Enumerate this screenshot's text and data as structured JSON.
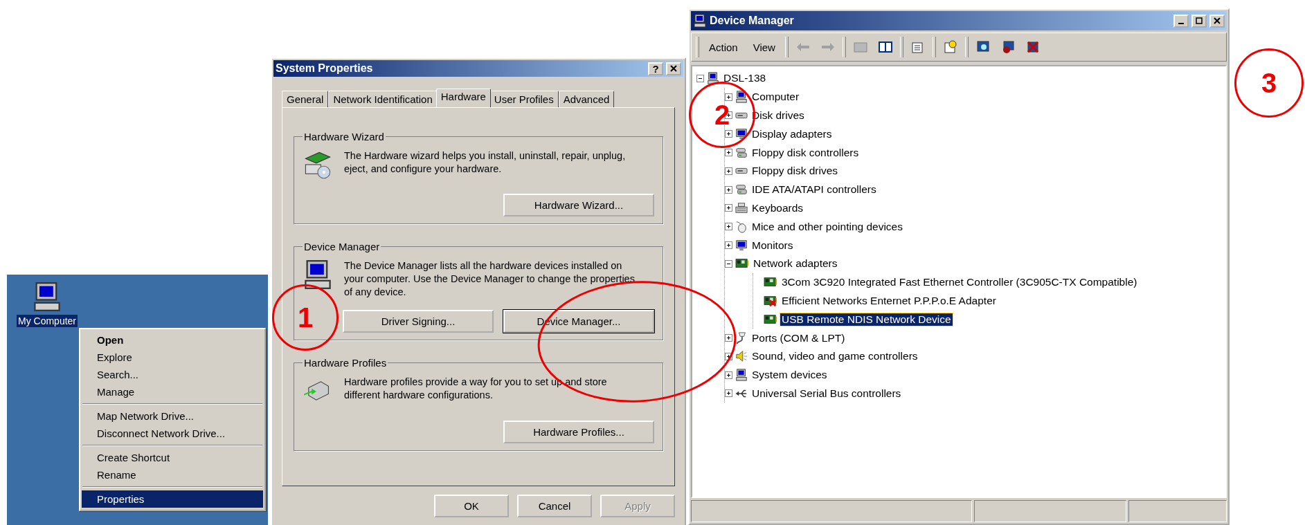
{
  "desktop": {
    "icon_label": "My Computer",
    "icon_selected": true,
    "context_menu": [
      [
        {
          "label": "Open",
          "default": true,
          "selected": false
        },
        {
          "label": "Explore",
          "default": false,
          "selected": false
        },
        {
          "label": "Search...",
          "default": false,
          "selected": false
        },
        {
          "label": "Manage",
          "default": false,
          "selected": false
        }
      ],
      [
        {
          "label": "Map Network Drive...",
          "default": false,
          "selected": false
        },
        {
          "label": "Disconnect Network Drive...",
          "default": false,
          "selected": false
        }
      ],
      [
        {
          "label": "Create Shortcut",
          "default": false,
          "selected": false
        },
        {
          "label": "Rename",
          "default": false,
          "selected": false
        }
      ],
      [
        {
          "label": "Properties",
          "default": false,
          "selected": true
        }
      ]
    ]
  },
  "system_properties": {
    "title": "System Properties",
    "help_button": "?",
    "tabs": [
      {
        "label": "General",
        "selected": false
      },
      {
        "label": "Network Identification",
        "selected": false
      },
      {
        "label": "Hardware",
        "selected": true
      },
      {
        "label": "User Profiles",
        "selected": false
      },
      {
        "label": "Advanced",
        "selected": false
      }
    ],
    "groups": [
      {
        "title": "Hardware Wizard",
        "kind": "wizard",
        "text": "The Hardware wizard helps you install, uninstall, repair, unplug, eject, and configure your hardware.",
        "buttons": [
          {
            "label": "Hardware Wizard...",
            "focused": false
          }
        ]
      },
      {
        "title": "Device Manager",
        "kind": "computer",
        "text": "The Device Manager lists all the hardware devices installed on your computer. Use the Device Manager to change the properties of any device.",
        "buttons": [
          {
            "label": "Driver Signing...",
            "focused": false
          },
          {
            "label": "Device Manager...",
            "focused": true
          }
        ]
      },
      {
        "title": "Hardware Profiles",
        "kind": "profiles",
        "text": "Hardware profiles provide a way for you to set up and store different hardware configurations.",
        "buttons": [
          {
            "label": "Hardware Profiles...",
            "focused": false
          }
        ]
      }
    ],
    "buttons": [
      {
        "label": "OK",
        "disabled": false
      },
      {
        "label": "Cancel",
        "disabled": false
      },
      {
        "label": "Apply",
        "disabled": true
      }
    ]
  },
  "device_manager": {
    "title": "Device Manager",
    "menus": [
      "Action",
      "View"
    ],
    "tree": {
      "label": "DSL-138",
      "kind": "computer",
      "expanded": true,
      "selected": false,
      "children": [
        {
          "label": "Computer",
          "kind": "computer",
          "expanded": false,
          "selected": false
        },
        {
          "label": "Disk drives",
          "kind": "disk",
          "expanded": false,
          "selected": false
        },
        {
          "label": "Display adapters",
          "kind": "monitor",
          "expanded": false,
          "selected": false
        },
        {
          "label": "Floppy disk controllers",
          "kind": "controller",
          "expanded": false,
          "selected": false
        },
        {
          "label": "Floppy disk drives",
          "kind": "disk",
          "expanded": false,
          "selected": false
        },
        {
          "label": "IDE ATA/ATAPI controllers",
          "kind": "controller",
          "expanded": false,
          "selected": false
        },
        {
          "label": "Keyboards",
          "kind": "keyboard",
          "expanded": false,
          "selected": false
        },
        {
          "label": "Mice and other pointing devices",
          "kind": "mouse",
          "expanded": false,
          "selected": false
        },
        {
          "label": "Monitors",
          "kind": "monitor",
          "expanded": false,
          "selected": false
        },
        {
          "label": "Network adapters",
          "kind": "card",
          "expanded": true,
          "selected": false,
          "children": [
            {
              "label": "3Com 3C920 Integrated Fast Ethernet Controller (3C905C-TX Compatible)",
              "kind": "card",
              "problem": false,
              "selected": false
            },
            {
              "label": "Efficient Networks Enternet P.P.P.o.E Adapter",
              "kind": "card",
              "problem": true,
              "selected": false
            },
            {
              "label": "USB Remote NDIS Network Device",
              "kind": "card",
              "problem": false,
              "selected": true
            }
          ]
        },
        {
          "label": "Ports (COM & LPT)",
          "kind": "port",
          "expanded": false,
          "selected": false
        },
        {
          "label": "Sound, video and game controllers",
          "kind": "sound",
          "expanded": false,
          "selected": false
        },
        {
          "label": "System devices",
          "kind": "computer",
          "expanded": false,
          "selected": false
        },
        {
          "label": "Universal Serial Bus controllers",
          "kind": "usb",
          "expanded": false,
          "selected": false
        }
      ]
    }
  },
  "annotations": [
    {
      "label": "1"
    },
    {
      "label": "2"
    },
    {
      "label": "3"
    }
  ]
}
